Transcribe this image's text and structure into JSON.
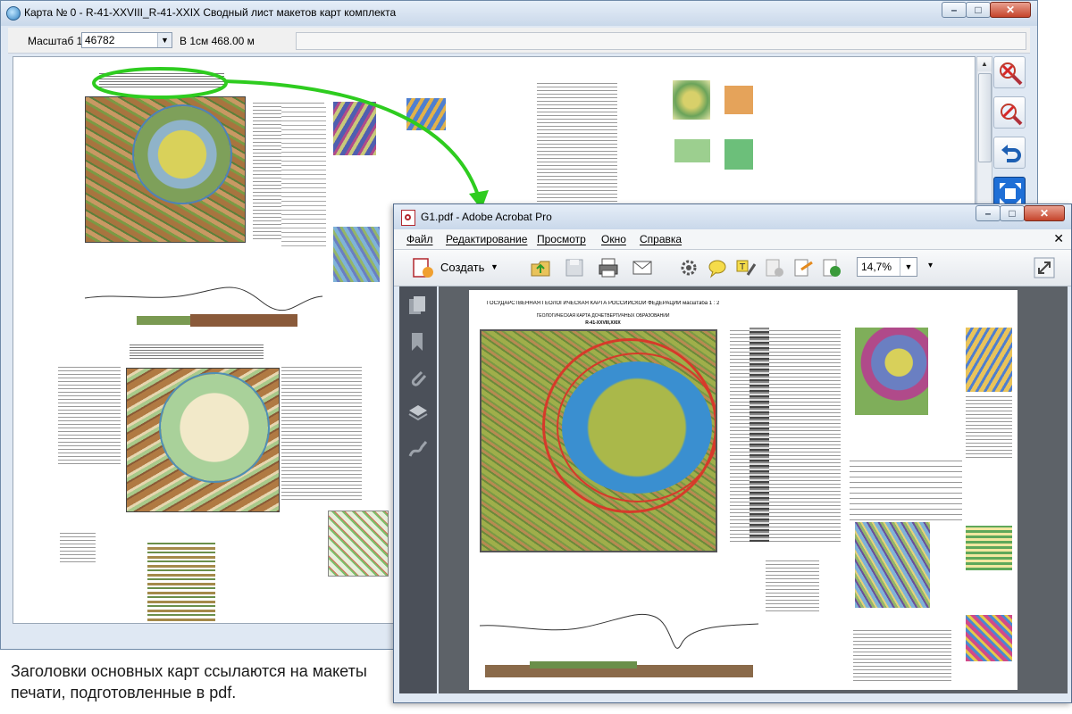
{
  "window_main": {
    "title": "Карта № 0 - R-41-XXVIII_R-41-XXIX  Сводный лист макетов карт комплекта",
    "buttons": {
      "minimize": "–",
      "maximize": "□",
      "close": "✕"
    }
  },
  "scale_bar": {
    "label": "Масштаб 1:",
    "value": "46782",
    "info": "В 1см 468.00 м"
  },
  "tools": [
    {
      "name": "zoom-out-tool",
      "icon": "magnifier-minus-icon"
    },
    {
      "name": "zoom-in-tool",
      "icon": "magnifier-plus-icon"
    },
    {
      "name": "undo-tool",
      "icon": "undo-arrow-icon"
    },
    {
      "name": "fit-tool",
      "icon": "fit-to-window-icon"
    }
  ],
  "window_pdf": {
    "title": "G1.pdf - Adobe Acrobat Pro",
    "menu": [
      "Файл",
      "Редактирование",
      "Просмотр",
      "Окно",
      "Справка"
    ],
    "create_label": "Создать",
    "zoom_value": "14,7%",
    "page": {
      "header_line1": "ГОСУДАРСТВЕННАЯ ГЕОЛОГИЧЕСКАЯ КАРТА РОССИЙСКОЙ ФЕДЕРАЦИИ масштаба 1 : 200 000",
      "header_line2": "ГЕОЛОГИЧЕСКАЯ КАРТА ДОЧЕТВЕРТИЧНЫХ ОБРАЗОВАНИЙ",
      "sheet_code": "R-41-XXVIII,XXIX"
    }
  },
  "caption": "Заголовки основных карт ссылаются на макеты печати, подготовленные в pdf.",
  "colors": {
    "link_arrow": "#2ecc1f",
    "map_brown": "#a8743f",
    "map_olive": "#aab84a",
    "map_blue": "#3a8fd0",
    "map_red": "#d63a2a"
  }
}
